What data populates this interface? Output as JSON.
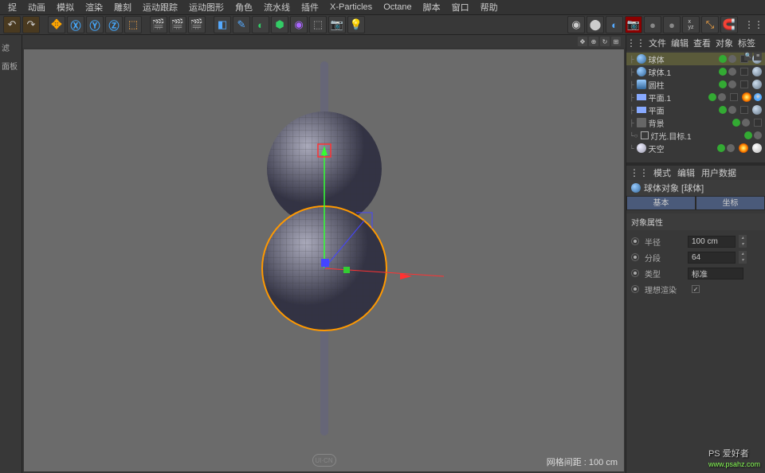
{
  "menu": [
    "捉",
    "动画",
    "模拟",
    "渲染",
    "雕刻",
    "运动跟踪",
    "运动图形",
    "角色",
    "流水线",
    "插件",
    "X-Particles",
    "Octane",
    "脚本",
    "窗口",
    "帮助"
  ],
  "left_tabs": [
    "滤",
    "面板"
  ],
  "objects_panel": {
    "tabs": [
      "文件",
      "编辑",
      "查看",
      "对象",
      "标签"
    ]
  },
  "tree": [
    {
      "icon": "sphere",
      "label": "球体",
      "sel": true,
      "tags": [
        "sq",
        "ball"
      ]
    },
    {
      "icon": "sphere",
      "label": "球体.1",
      "tags": [
        "sq",
        "ball"
      ]
    },
    {
      "icon": "cyl",
      "label": "圆柱",
      "tags": [
        "sq",
        "ball"
      ]
    },
    {
      "icon": "plane",
      "label": "平面.1",
      "tags": [
        "sq",
        "glow",
        "check"
      ]
    },
    {
      "icon": "plane",
      "label": "平面",
      "tags": [
        "sq",
        "ball"
      ]
    },
    {
      "icon": "bg",
      "label": "背景",
      "tags": [
        "sq"
      ]
    },
    {
      "icon": "null",
      "label": "灯光.目标.1",
      "tags": [
        "sq"
      ]
    },
    {
      "icon": "sky",
      "label": "天空",
      "tags": [
        "glow",
        "white"
      ]
    }
  ],
  "attr": {
    "tabs": [
      "模式",
      "编辑",
      "用户数据"
    ],
    "title": "球体对象 [球体]",
    "subtabs": [
      "基本",
      "坐标"
    ],
    "section": "对象属性",
    "rows": {
      "radius": {
        "label": "半径",
        "value": "100 cm"
      },
      "segments": {
        "label": "分段",
        "value": "64"
      },
      "type": {
        "label": "类型",
        "value": "标准"
      },
      "render": {
        "label": "理想渲染",
        "checked": true
      }
    }
  },
  "viewport": {
    "grid": "网格间距 : 100 cm",
    "logo": "UI·CN"
  },
  "watermark": {
    "title": "PS 爱好者",
    "url": "www.psahz.com"
  }
}
